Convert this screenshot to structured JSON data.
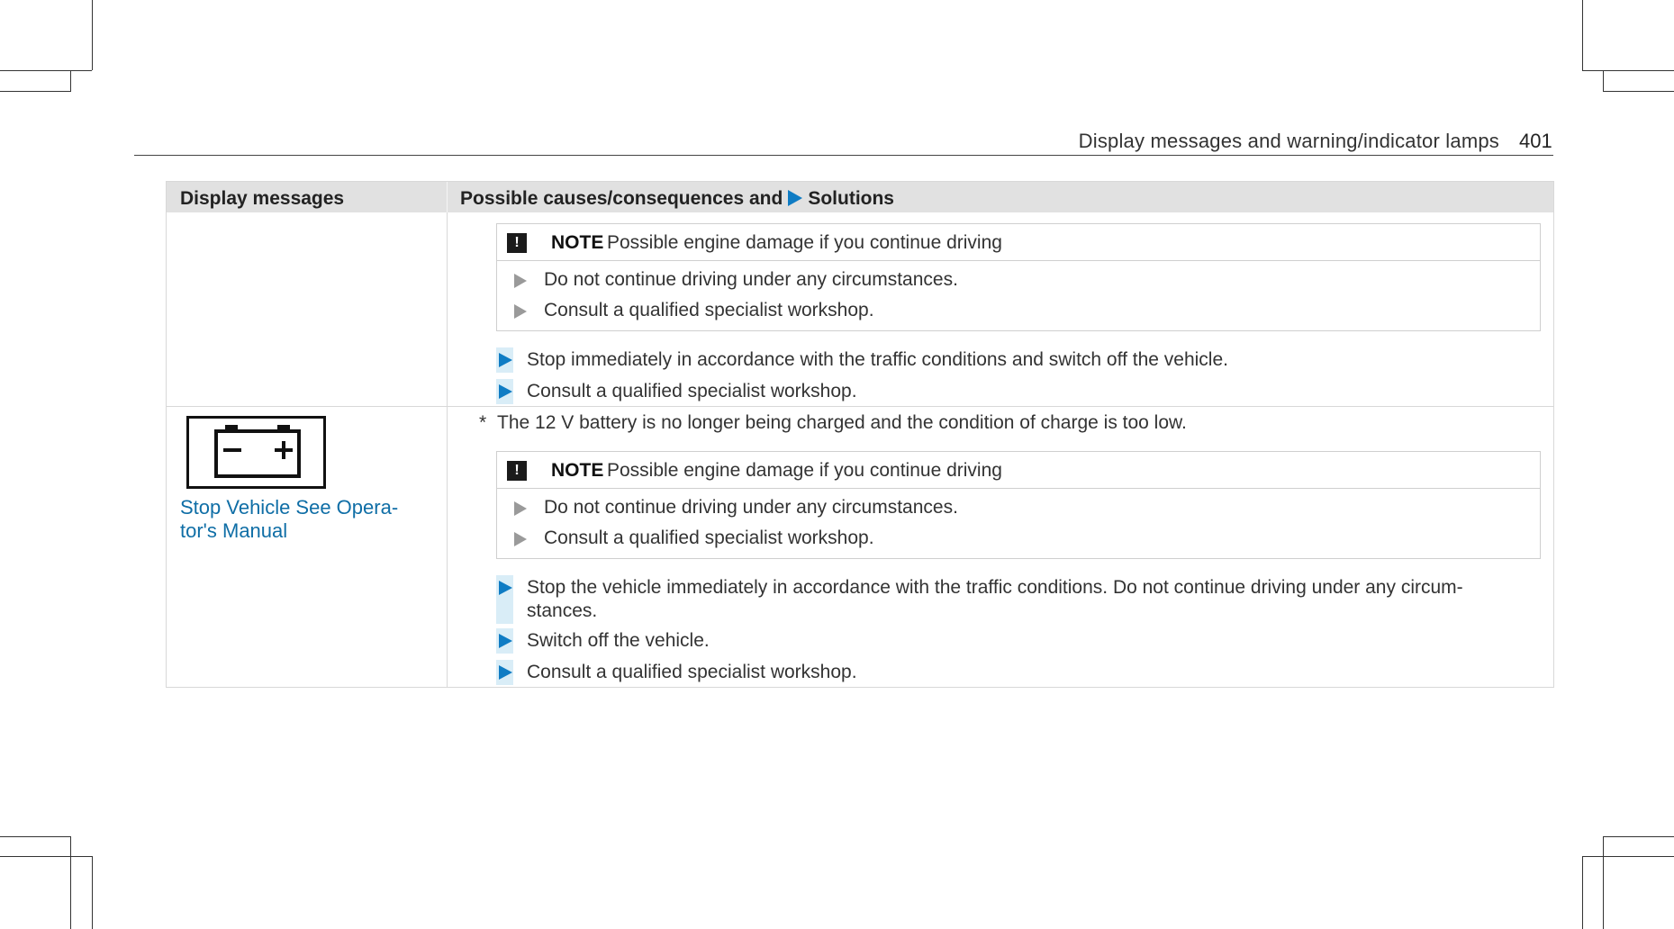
{
  "header": {
    "title": "Display messages and warning/indicator lamps",
    "page_number": "401"
  },
  "table": {
    "col_display_messages": "Display messages",
    "col_causes_prefix": "Possible causes/consequences and",
    "col_causes_suffix": "Solutions"
  },
  "row1": {
    "note": {
      "keyword": "NOTE",
      "text": "Possible engine damage if you continue driving",
      "items": [
        "Do not continue driving under any circumstances.",
        "Consult a qualified specialist workshop."
      ]
    },
    "steps": [
      "Stop immediately in accordance with the traffic conditions and switch off the vehicle.",
      "Consult a qualified specialist workshop."
    ]
  },
  "row2": {
    "message_line1": "Stop Vehicle See Opera-",
    "message_line2": "tor's Manual",
    "cause": "The 12 V battery is no longer being charged and the condition of charge is too low.",
    "asterisk": "*",
    "note": {
      "keyword": "NOTE",
      "text": "Possible engine damage if you continue driving",
      "items": [
        "Do not continue driving under any circumstances.",
        "Consult a qualified specialist workshop."
      ]
    },
    "steps": [
      "Stop the vehicle immediately in accordance with the traffic conditions. Do not continue driving under any circum-",
      "stances.",
      "Switch off the vehicle.",
      "Consult a qualified specialist workshop."
    ]
  },
  "colors": {
    "accent": "#0f7cc4",
    "link": "#0f6ea6",
    "header_bg": "#e1e1e1"
  },
  "icons": [
    "battery-warning-icon",
    "exclamation-icon",
    "arrow-right-icon"
  ]
}
